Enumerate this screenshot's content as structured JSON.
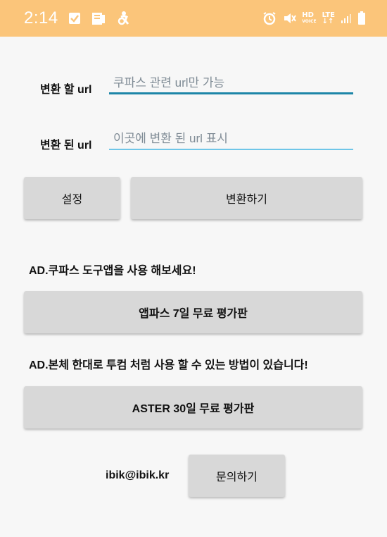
{
  "status_bar": {
    "time": "2:14",
    "left_icons": [
      "checkbox-icon",
      "clipboard-icon",
      "accessibility-icon"
    ],
    "right_icons": [
      "alarm-icon",
      "mute-icon",
      "hd-icon",
      "lte-icon",
      "signal-icon",
      "battery-icon"
    ],
    "hd_label": "HD",
    "hd_sub": "VOICE",
    "lte_label": "LTE"
  },
  "form": {
    "source_label": "변환 할 url",
    "source_placeholder": "쿠파스 관련 url만 가능",
    "result_label": "변환 된 url",
    "result_placeholder": "이곳에 변환 된 url 표시"
  },
  "buttons": {
    "settings": "설정",
    "convert": "변환하기",
    "ad1": "앱파스 7일 무료 평가판",
    "ad2": "ASTER 30일 무료 평가판",
    "inquiry": "문의하기"
  },
  "ads": {
    "ad1_text": "AD.쿠파스 도구앱을 사용 해보세요!",
    "ad2_text": "AD.본체 한대로 투컴 처럼 사용 할 수 있는 방법이 있습니다!"
  },
  "contact": {
    "email": "ibik@ibik.kr"
  },
  "colors": {
    "status_bar": "#fbc57a",
    "focused_underline": "#1d86a8",
    "underline": "#6fc6e8",
    "button_bg": "#d8d8d8"
  }
}
